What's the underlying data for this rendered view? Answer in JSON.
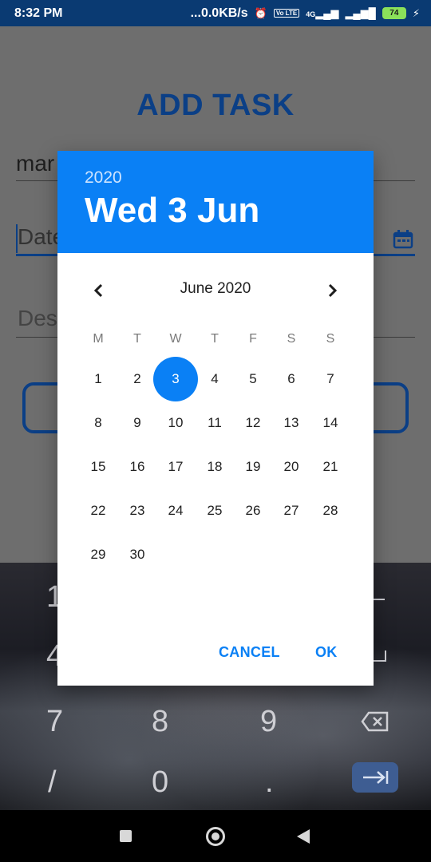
{
  "status_bar": {
    "time": "8:32 PM",
    "network_speed": "...0.0KB/s",
    "signal_label": "4G",
    "volte_label": "Vo LTE",
    "battery": "74"
  },
  "app": {
    "title": "ADD TASK",
    "name_value": "mar",
    "date_placeholder": "Date",
    "description_placeholder": "Des"
  },
  "dialog": {
    "header_year": "2020",
    "header_date": "Wed 3 Jun",
    "month_label": "June 2020",
    "weekdays": [
      "M",
      "T",
      "W",
      "T",
      "F",
      "S",
      "S"
    ],
    "days": [
      "1",
      "2",
      "3",
      "4",
      "5",
      "6",
      "7",
      "8",
      "9",
      "10",
      "11",
      "12",
      "13",
      "14",
      "15",
      "16",
      "17",
      "18",
      "19",
      "20",
      "21",
      "22",
      "23",
      "24",
      "25",
      "26",
      "27",
      "28",
      "29",
      "30"
    ],
    "selected_day": "3",
    "first_weekday_index": 0,
    "cancel_label": "CANCEL",
    "ok_label": "OK",
    "accent_color": "#0a80f5"
  },
  "keyboard": {
    "visible_keys": [
      "1",
      "4",
      "7",
      "8",
      "9",
      "/",
      "0",
      "."
    ],
    "icons": [
      "backspace-icon",
      "tab-enter-icon"
    ]
  },
  "nav_bar": {
    "icons": [
      "recents-square-icon",
      "home-circle-icon",
      "back-triangle-icon"
    ]
  }
}
